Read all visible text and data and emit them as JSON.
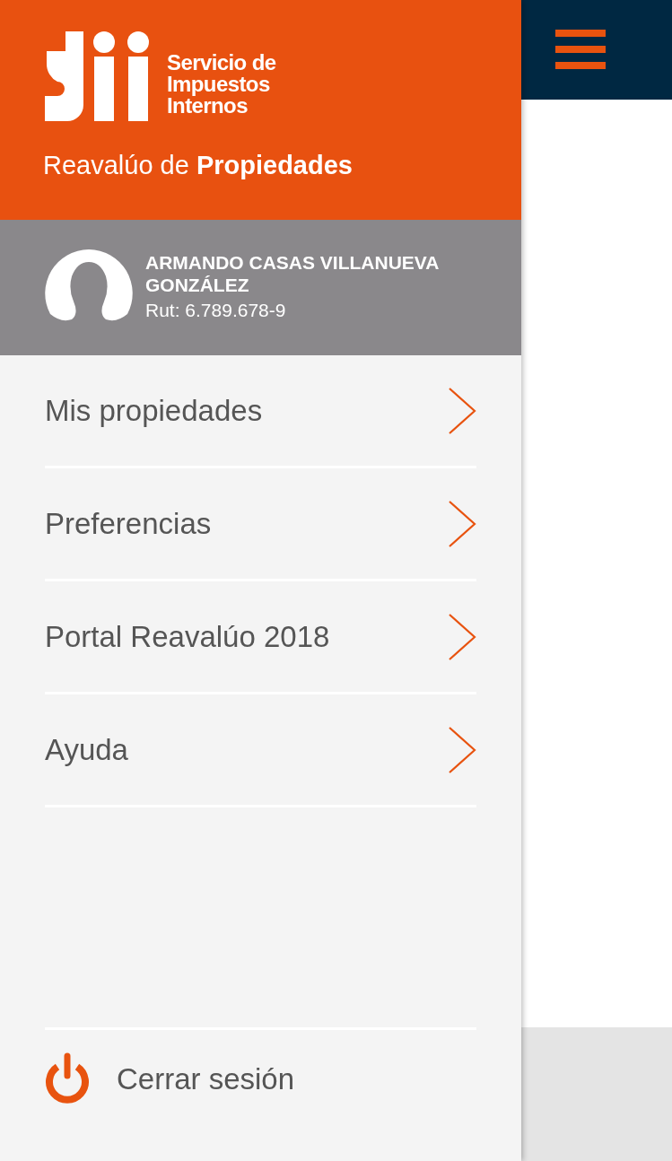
{
  "brand": {
    "org_name": [
      "Servicio de",
      "Impuestos",
      "Internos"
    ],
    "app_title": "Reavalúo de **Propiedades**"
  },
  "user": {
    "name": "ARMANDO CASAS VILLANUEVA GONZÁLEZ",
    "rut_label": "Rut:",
    "rut": "6.789.678-9"
  },
  "menu": [
    {
      "label": "Mis propiedades"
    },
    {
      "label": "Preferencias"
    },
    {
      "label": "Portal Reavalúo 2018"
    },
    {
      "label": "Ayuda"
    }
  ],
  "logout": {
    "label": "Cerrar sesión"
  }
}
